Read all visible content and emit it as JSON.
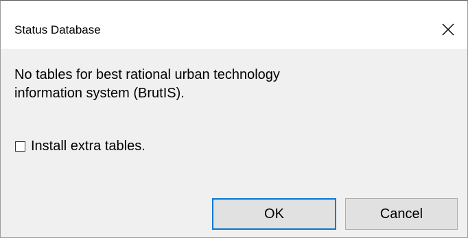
{
  "window": {
    "title": "Status Database",
    "close_icon": "close-icon"
  },
  "message": {
    "line1": "No tables for best rational urban technology",
    "line2": "information system (BrutIS)."
  },
  "checkbox": {
    "label": "Install extra tables.",
    "checked": false
  },
  "buttons": {
    "ok_label": "OK",
    "cancel_label": "Cancel"
  },
  "colors": {
    "default_button_border": "#0078d7",
    "dialog_background": "#f0f0f0",
    "titlebar_background": "#ffffff"
  }
}
